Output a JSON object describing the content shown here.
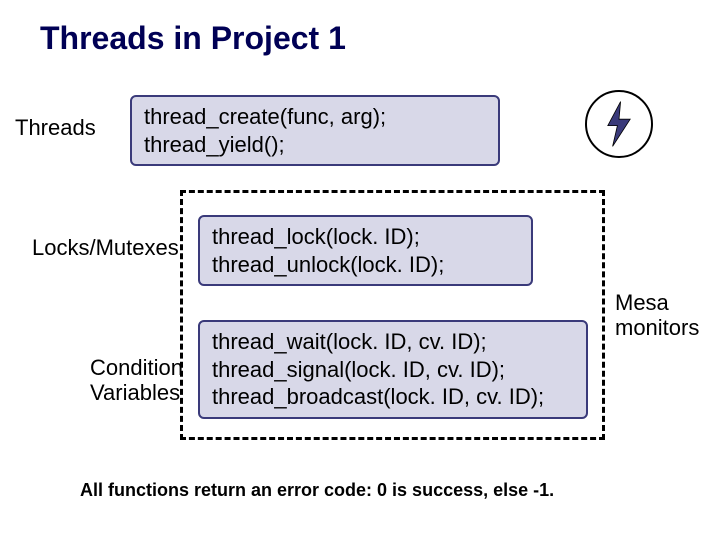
{
  "title": "Threads in Project 1",
  "labels": {
    "threads": "Threads",
    "locks": "Locks/Mutexes",
    "condvar_line1": "Condition",
    "condvar_line2": "Variables",
    "mesa_line1": "Mesa",
    "mesa_line2": "monitors"
  },
  "code": {
    "threads_line1": "thread_create(func, arg);",
    "threads_line2": "thread_yield();",
    "locks_line1": "thread_lock(lock. ID);",
    "locks_line2": "thread_unlock(lock. ID);",
    "cond_line1": "thread_wait(lock. ID, cv. ID);",
    "cond_line2": "thread_signal(lock. ID, cv. ID);",
    "cond_line3": "thread_broadcast(lock. ID, cv. ID);"
  },
  "footer": "All functions return an error code: 0 is success, else -1."
}
